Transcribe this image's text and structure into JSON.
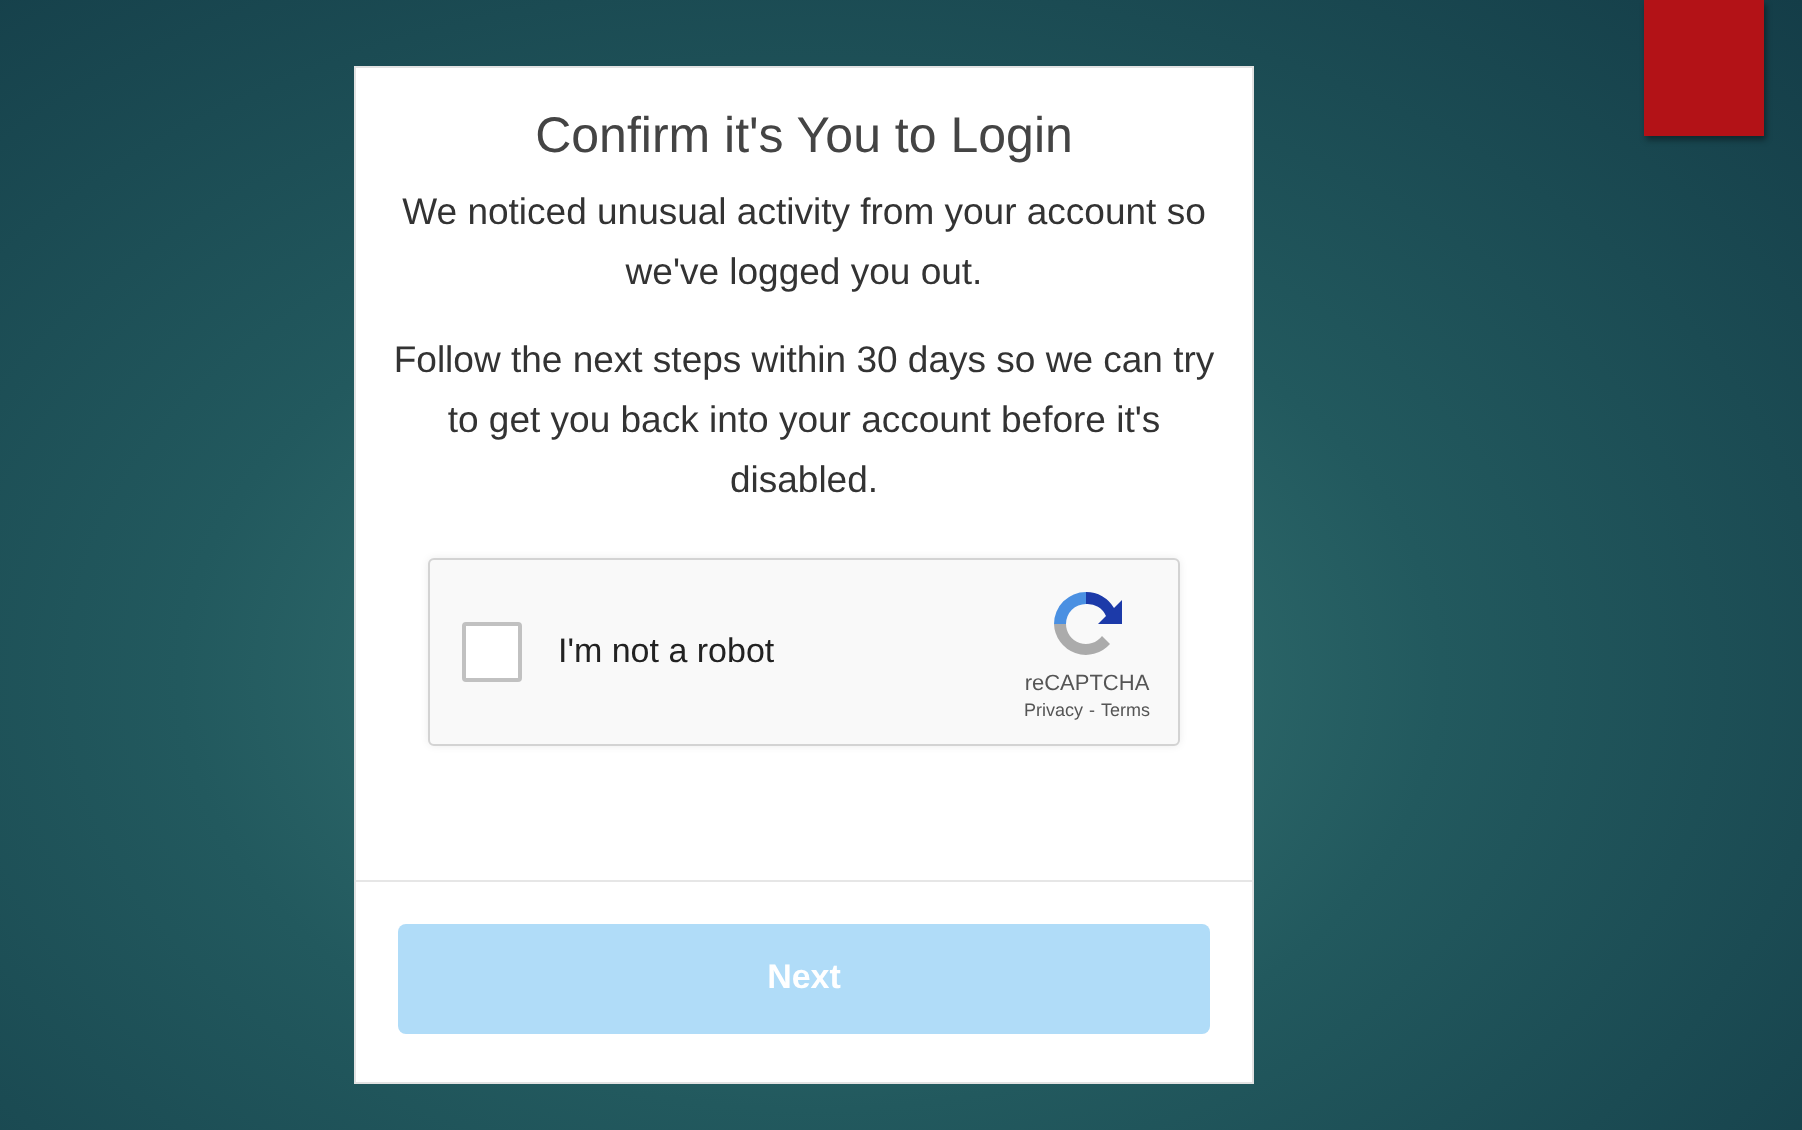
{
  "dialog": {
    "title": "Confirm it's You to Login",
    "paragraphs": [
      "We noticed unusual activity from your account so we've logged you out.",
      "Follow the next steps within 30 days so we can try to get you back into your account before it's disabled."
    ],
    "captcha": {
      "label": "I'm not a robot",
      "checked": false,
      "brand": "reCAPTCHA",
      "links": [
        "Privacy",
        "-",
        "Terms"
      ]
    },
    "button": {
      "label": "Next",
      "disabled": true
    }
  }
}
